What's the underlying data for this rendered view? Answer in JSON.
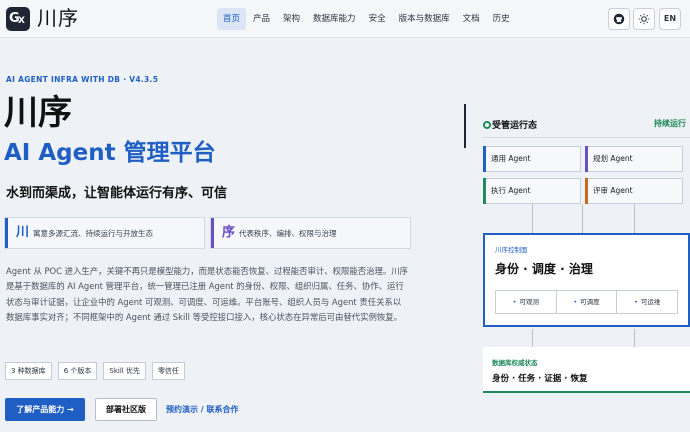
{
  "nav": {
    "logo_glyph_a": "G",
    "logo_glyph_b": "X",
    "brand": "川序",
    "links": [
      {
        "label": "首页",
        "active": true
      },
      {
        "label": "产品"
      },
      {
        "label": "架构"
      },
      {
        "label": "数据库能力"
      },
      {
        "label": "安全"
      },
      {
        "label": "版本与数据库"
      },
      {
        "label": "文档"
      },
      {
        "label": "历史"
      }
    ],
    "github_icon": "github-icon",
    "theme_icon": "theme-toggle-icon",
    "lang_label": "EN"
  },
  "hero": {
    "eyebrow": "AI AGENT INFRA WITH DB · V4.3.5",
    "title_cn": "川序",
    "title_en": "AI Agent 管理平台",
    "tagline": "水到而渠成，让智能体运行有序、可信",
    "features": [
      {
        "char": "川",
        "text": "寓意多源汇流、持续运行与开放生态",
        "color": "#1f5fc4"
      },
      {
        "char": "序",
        "text": "代表秩序、编排、权限与治理",
        "color": "#6a4fc4"
      }
    ],
    "paragraph": "Agent 从 POC 进入生产，关键不再只是模型能力，而是状态能否恢复、过程能否审计、权限能否治理。川序是基于数据库的 AI Agent 管理平台，统一管理已注册 Agent 的身份、权限、组织归属、任务、协作、运行状态与审计证据，让企业中的 Agent 可观测、可调度、可运维。平台账号、组织人员与 Agent 责任关系以数据库事实对齐；不同框架中的 Agent 通过 Skill 等受控接口接入，核心状态在异常后可由替代实例恢复。",
    "tags": [
      "3 种数据库",
      "6 个版本",
      "Skill 优先",
      "零信任"
    ],
    "cta_primary": "了解产品能力 →",
    "cta_secondary": "部署社区版",
    "cta_link": "预约演示 / 联系合作"
  },
  "panel": {
    "title": "受管运行态",
    "status": "持续运行",
    "agents": [
      {
        "label": "通用 Agent",
        "color": "#1f5fc4"
      },
      {
        "label": "规划 Agent",
        "color": "#6a4fc4"
      },
      {
        "label": "执行 Agent",
        "color": "#1f8a5b"
      },
      {
        "label": "评审 Agent",
        "color": "#c46a1f"
      }
    ],
    "control": {
      "label": "川序控制面",
      "main": "身份 · 调度 · 治理",
      "pills": [
        "可观测",
        "可调度",
        "可运维"
      ]
    },
    "db": {
      "label": "数据库权威状态",
      "main": "身份 · 任务 · 证据 · 恢复"
    }
  }
}
